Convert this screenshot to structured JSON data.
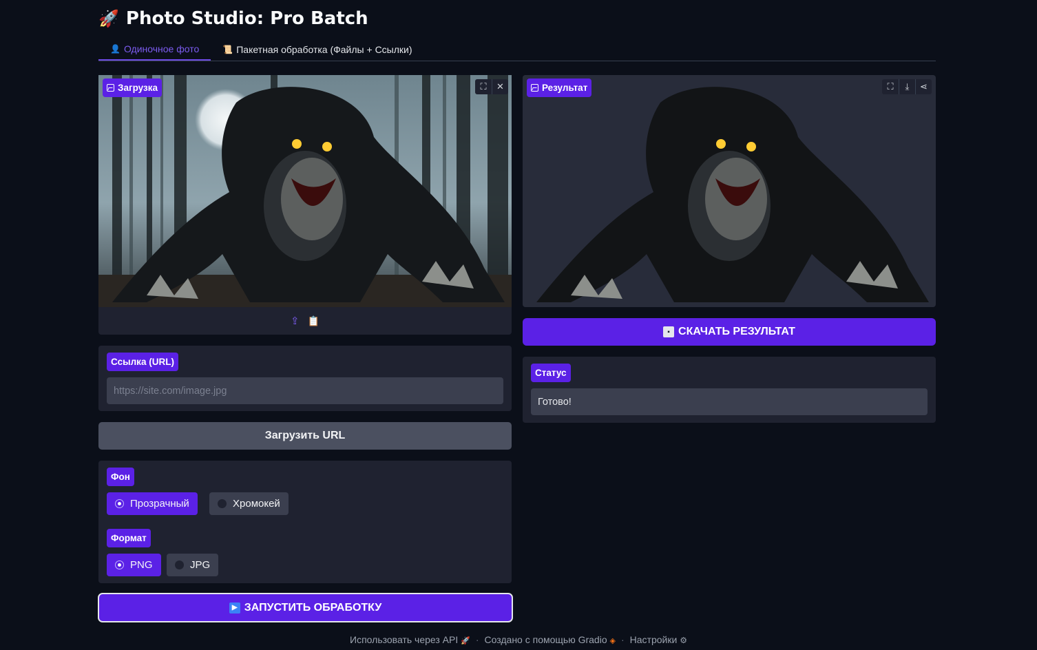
{
  "app": {
    "title_icon": "rocket-icon",
    "title": "Photo Studio: Pro Batch"
  },
  "tabs": [
    {
      "icon": "bust-icon",
      "label": "Одиночное фото",
      "active": true
    },
    {
      "icon": "scroll-icon",
      "label": "Пакетная обработка (Файлы + Ссылки)",
      "active": false
    }
  ],
  "upload": {
    "label": "Загрузка",
    "image": "horror creature photo",
    "toolbar": [
      "fullscreen-icon",
      "close-icon"
    ],
    "source_icons": [
      "upload-icon",
      "clipboard-icon"
    ]
  },
  "url": {
    "label": "Ссылка (URL)",
    "value": "",
    "placeholder": "https://site.com/image.jpg",
    "load_button": "Загрузить URL"
  },
  "background": {
    "label": "Фон",
    "options": [
      "Прозрачный",
      "Хромокей"
    ],
    "selected": "Прозрачный"
  },
  "format": {
    "label": "Формат",
    "options": [
      "PNG",
      "JPG"
    ],
    "selected": "PNG"
  },
  "run_button": "ЗАПУСТИТЬ ОБРАБОТКУ",
  "result": {
    "label": "Результат",
    "toolbar": [
      "fullscreen-icon",
      "download-icon",
      "share-icon"
    ],
    "download_button": "СКАЧАТЬ РЕЗУЛЬТАТ"
  },
  "status": {
    "label": "Статус",
    "value": "Готово!"
  },
  "footer": {
    "api": "Использовать через API",
    "built": "Создано с помощью Gradio",
    "settings": "Настройки",
    "separator": "·"
  },
  "colors": {
    "accent": "#5b21e6",
    "background": "#0b0f19",
    "panel": "#1f2230"
  }
}
